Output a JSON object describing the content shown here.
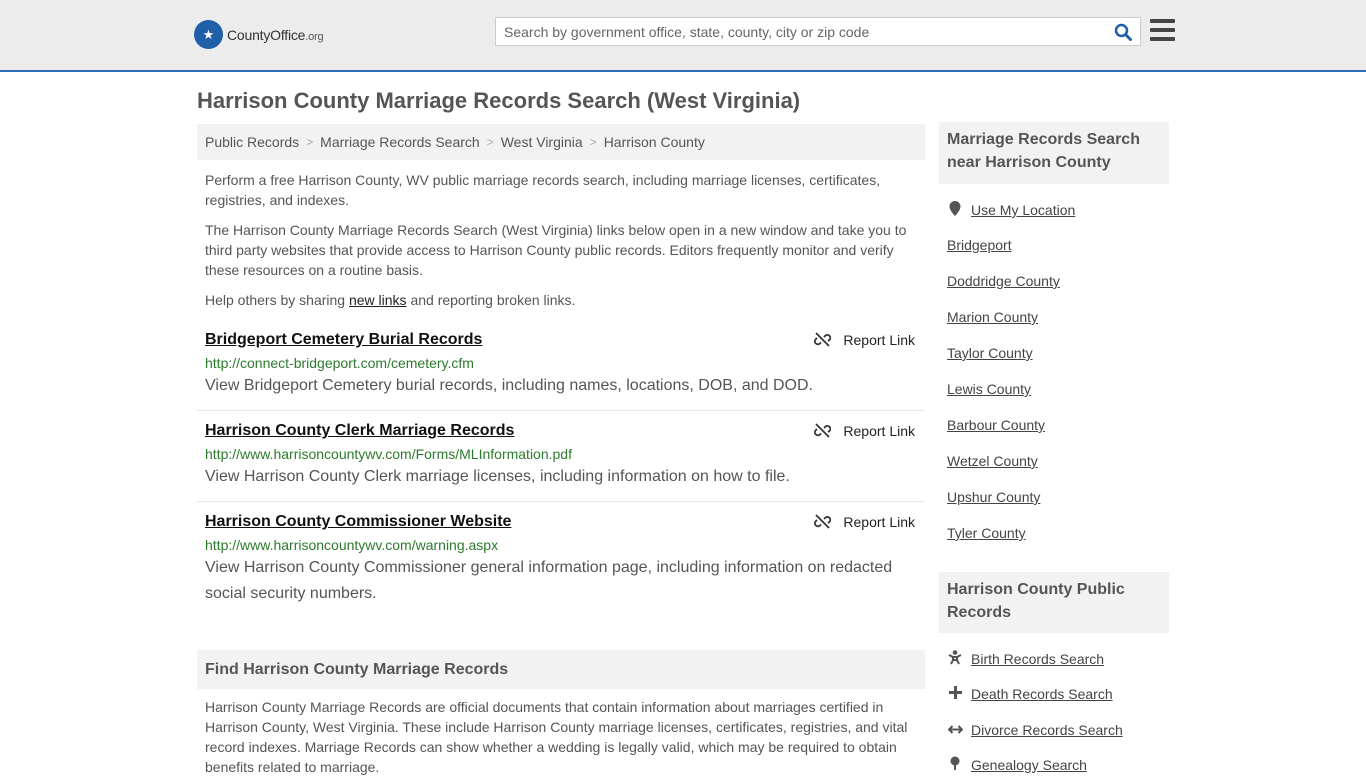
{
  "header": {
    "logo_brand": "CountyOffice",
    "logo_tld": ".org",
    "search_placeholder": "Search by government office, state, county, city or zip code"
  },
  "page_title": "Harrison County Marriage Records Search (West Virginia)",
  "breadcrumb": [
    "Public Records",
    "Marriage Records Search",
    "West Virginia",
    "Harrison County"
  ],
  "intro": {
    "p1": "Perform a free Harrison County, WV public marriage records search, including marriage licenses, certificates, registries, and indexes.",
    "p2": "The Harrison County Marriage Records Search (West Virginia) links below open in a new window and take you to third party websites that provide access to Harrison County public records. Editors frequently monitor and verify these resources on a routine basis.",
    "p3_before": "Help others by sharing ",
    "p3_link": "new links",
    "p3_after": " and reporting broken links."
  },
  "report_label": "Report Link",
  "results": [
    {
      "title": "Bridgeport Cemetery Burial Records",
      "url": "http://connect-bridgeport.com/cemetery.cfm",
      "desc": "View Bridgeport Cemetery burial records, including names, locations, DOB, and DOD."
    },
    {
      "title": "Harrison County Clerk Marriage Records",
      "url": "http://www.harrisoncountywv.com/Forms/MLInformation.pdf",
      "desc": "View Harrison County Clerk marriage licenses, including information on how to file."
    },
    {
      "title": "Harrison County Commissioner Website",
      "url": "http://www.harrisoncountywv.com/warning.aspx",
      "desc": "View Harrison County Commissioner general information page, including information on redacted social security numbers."
    }
  ],
  "find_section": {
    "heading": "Find Harrison County Marriage Records",
    "text": "Harrison County Marriage Records are official documents that contain information about marriages certified in Harrison County, West Virginia. These include Harrison County marriage licenses, certificates, registries, and vital record indexes. Marriage Records can show whether a wedding is legally valid, which may be required to obtain benefits related to marriage."
  },
  "sidebar": {
    "nearby_heading": "Marriage Records Search near Harrison County",
    "use_location": "Use My Location",
    "nearby": [
      "Bridgeport",
      "Doddridge County",
      "Marion County",
      "Taylor County",
      "Lewis County",
      "Barbour County",
      "Wetzel County",
      "Upshur County",
      "Tyler County"
    ],
    "public_heading": "Harrison County Public Records",
    "public_links": [
      {
        "label": "Birth Records Search",
        "icon": "baby-icon"
      },
      {
        "label": "Death Records Search",
        "icon": "cross-icon"
      },
      {
        "label": "Divorce Records Search",
        "icon": "split-arrows-icon"
      },
      {
        "label": "Genealogy Search",
        "icon": "tree-icon"
      }
    ]
  }
}
